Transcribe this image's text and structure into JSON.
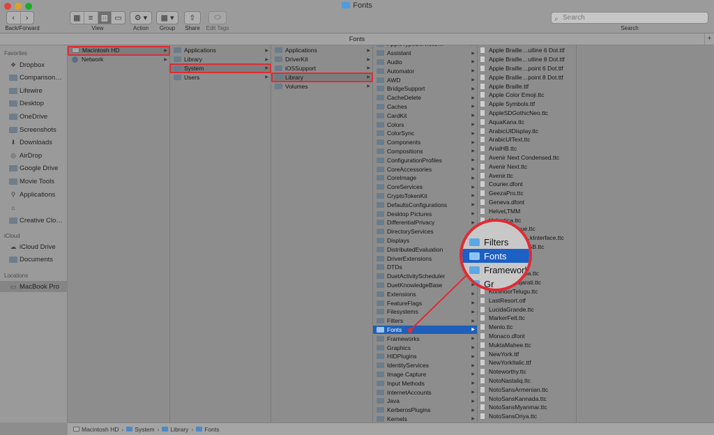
{
  "window": {
    "title": "Fonts"
  },
  "toolbar": {
    "back_forward_label": "Back/Forward",
    "view_label": "View",
    "action_label": "Action",
    "group_label": "Group",
    "share_label": "Share",
    "edit_tags_label": "Edit Tags",
    "search_placeholder": "Search",
    "search_label": "Search"
  },
  "path_header": {
    "title": "Fonts"
  },
  "sidebar": {
    "favorites_heading": "Favorites",
    "favorites": [
      {
        "label": "Dropbox",
        "icon": "dropbox-icon"
      },
      {
        "label": "Comparison…",
        "icon": "folder-icon"
      },
      {
        "label": "Lifewire",
        "icon": "folder-icon"
      },
      {
        "label": "Desktop",
        "icon": "folder-icon"
      },
      {
        "label": "OneDrive",
        "icon": "folder-icon"
      },
      {
        "label": "Screenshots",
        "icon": "folder-icon"
      },
      {
        "label": "Downloads",
        "icon": "download-icon"
      },
      {
        "label": "AirDrop",
        "icon": "airdrop-icon"
      },
      {
        "label": "Google Drive",
        "icon": "folder-icon"
      },
      {
        "label": "Movie Tools",
        "icon": "folder-icon"
      },
      {
        "label": "Applications",
        "icon": "applications-icon"
      },
      {
        "label": "",
        "icon": "home-icon"
      },
      {
        "label": "Creative Clo…",
        "icon": "folder-icon"
      }
    ],
    "icloud_heading": "iCloud",
    "icloud": [
      {
        "label": "iCloud Drive",
        "icon": "cloud-icon"
      },
      {
        "label": "Documents",
        "icon": "folder-icon"
      }
    ],
    "locations_heading": "Locations",
    "locations": [
      {
        "label": "MacBook Pro",
        "icon": "laptop-icon"
      }
    ]
  },
  "columns": {
    "col1": [
      "Macintosh HD",
      "Network"
    ],
    "col2": [
      "Applications",
      "Library",
      "System",
      "Users"
    ],
    "col3": [
      "Applications",
      "DriverKit",
      "iOSSupport",
      "Library",
      "Volumes"
    ],
    "col4": [
      "AppleTypeServices…",
      "Assistant",
      "Audio",
      "Automator",
      "AWD",
      "BridgeSupport",
      "CacheDelete",
      "Caches",
      "CardKit",
      "Colors",
      "ColorSync",
      "Components",
      "Compositions",
      "ConfigurationProfiles",
      "CoreAccessories",
      "CoreImage",
      "CoreServices",
      "CryptoTokenKit",
      "DefaultsConfigurations",
      "Desktop Pictures",
      "DifferentialPrivacy",
      "DirectoryServices",
      "Displays",
      "DistributedEvaluation",
      "DriverExtensions",
      "DTDs",
      "DuetActivityScheduler",
      "DuetKnowledgeBase",
      "Extensions",
      "FeatureFlags",
      "Filesystems",
      "Filters",
      "Fonts",
      "Frameworks",
      "Graphics",
      "HIDPlugins",
      "IdentityServices",
      "Image Capture",
      "Input Methods",
      "InternetAccounts",
      "Java",
      "KerberosPlugins",
      "Kernels"
    ],
    "col5": [
      "Apple Braille…utline 6 Dot.ttf",
      "Apple Braille…utline 8 Dot.ttf",
      "Apple Braille…point 6 Dot.ttf",
      "Apple Braille…point 8 Dot.ttf",
      "Apple Braille.ttf",
      "Apple Color Emoji.ttc",
      "Apple Symbols.ttf",
      "AppleSDGothicNeo.ttc",
      "AquaKana.ttc",
      "ArabicUIDisplay.ttc",
      "ArabicUIText.ttc",
      "ArialHB.ttc",
      "Avenir Next Condensed.ttc",
      "Avenir Next.ttc",
      "Avenir.ttc",
      "Courier.dfont",
      "GeezaPro.ttc",
      "Geneva.dfont",
      "HelveLTMM",
      "Helvetica.ttc",
      "HelveticaNeue.ttc",
      "HelveticaNeu…kInterface.ttc",
      "Hiragino Sans GB.ttc",
      "…ttf",
      "…ttc",
      "KohinoorBangla.ttc",
      "KohinoorGujarati.ttc",
      "KohinoorTelugu.ttc",
      "LastResort.otf",
      "LucidaGrande.ttc",
      "MarkerFelt.ttc",
      "Menlo.ttc",
      "Monaco.dfont",
      "MuktaMahee.ttc",
      "NewYork.ttf",
      "NewYorkItalic.ttf",
      "Noteworthy.ttc",
      "NotoNastaliq.ttc",
      "NotoSansArmenian.ttc",
      "NotoSansKannada.ttc",
      "NotoSansMyanmar.ttc",
      "NotoSansOriya.ttc"
    ]
  },
  "magnifier": {
    "items": [
      "Filters",
      "Fonts",
      "Frameworks",
      "Gr"
    ]
  },
  "statusbar": {
    "crumbs": [
      "Macintosh HD",
      "System",
      "Library",
      "Fonts"
    ]
  },
  "colors": {
    "selection": "#1f5fb9",
    "highlight_box": "#e02b33"
  }
}
